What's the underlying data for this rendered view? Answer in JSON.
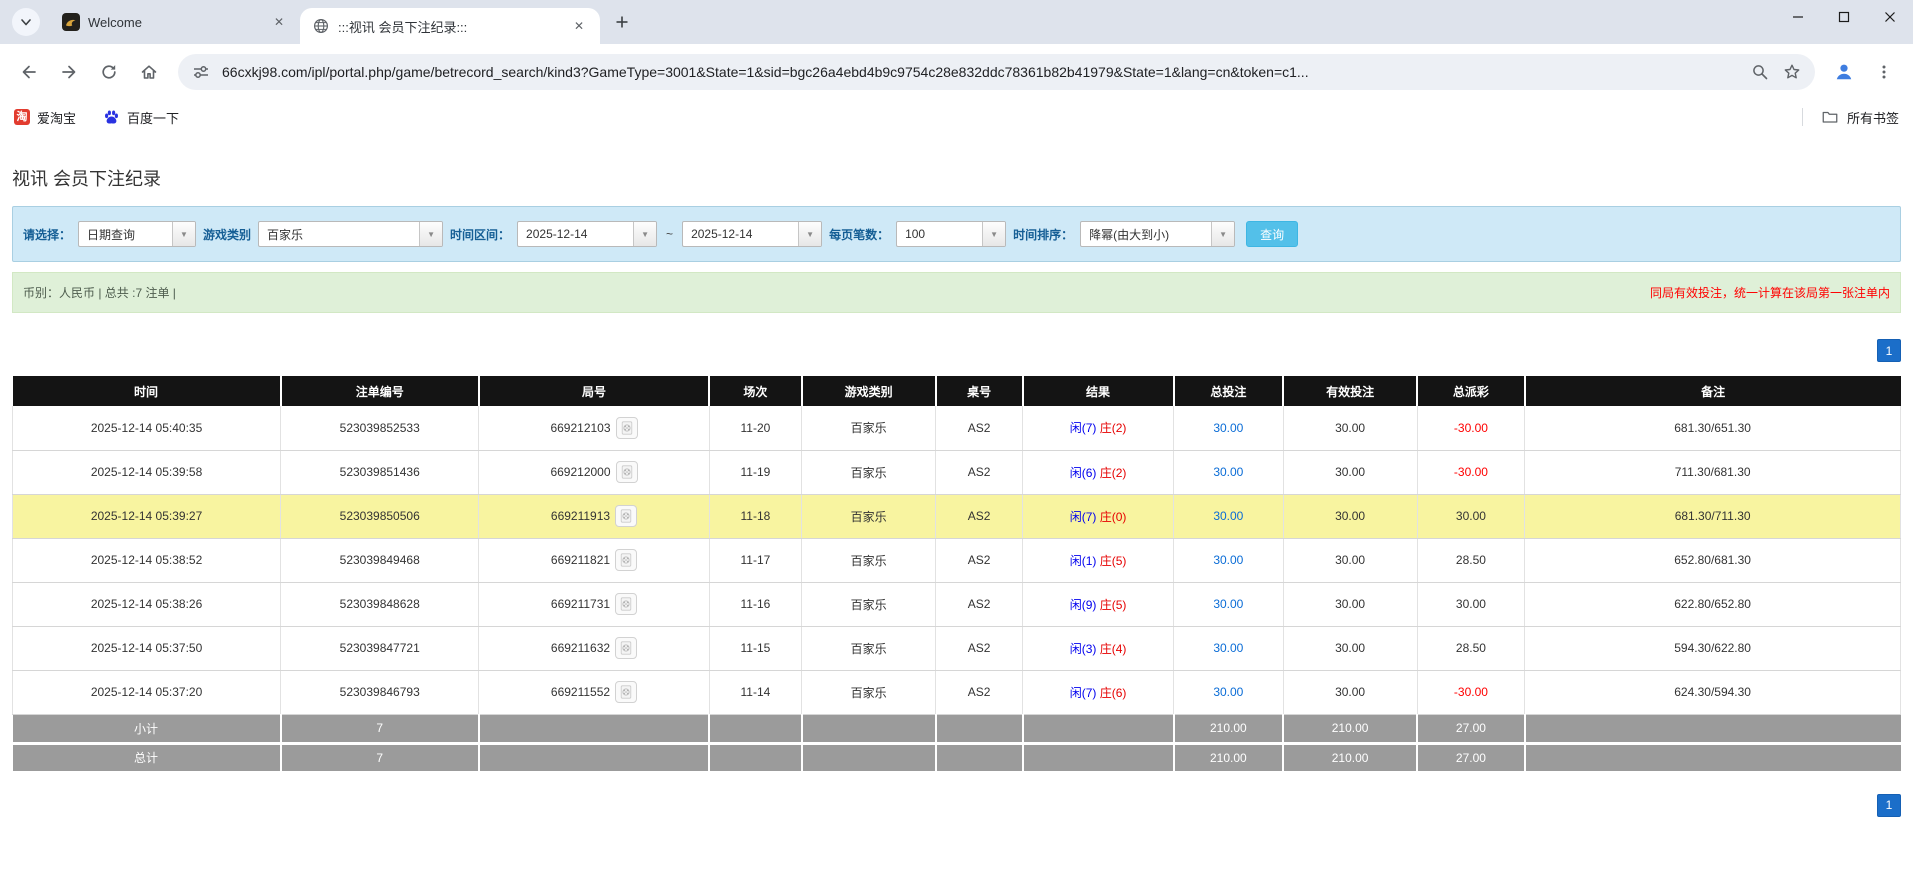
{
  "browser": {
    "tabs": [
      {
        "title": "Welcome"
      },
      {
        "title": ":::视讯 会员下注纪录:::"
      }
    ],
    "url": "66cxkj98.com/ipl/portal.php/game/betrecord_search/kind3?GameType=3001&State=1&sid=bgc26a4ebd4b9c9754c28e832ddc78361b82b41979&State=1&lang=cn&token=c1...",
    "bookmarks": {
      "taobao": "爱淘宝",
      "taobao_icon_char": "淘",
      "baidu": "百度一下",
      "all_bookmarks": "所有书签"
    }
  },
  "icons": {
    "dropdown": "▼",
    "tab_close": "✕"
  },
  "colors": {
    "accent_blue_button": "#53c0e9",
    "pager_blue": "#1b6ec9",
    "filter_panel_bg": "#cfe9f7",
    "info_bar_bg": "#dff0d8",
    "table_header_bg": "#141414",
    "highlight_row_bg": "#f8f4a0",
    "summary_row_bg": "#9b9b9b",
    "link_blue": "#0a6cd6",
    "negative_red": "#ff0000",
    "result_player_blue": "#0000ee",
    "result_banker_red": "#e60000"
  },
  "page": {
    "title": "视讯 会员下注纪录",
    "filters": {
      "select_label": "请选择：",
      "select_value": "日期查询",
      "game_type_label": "游戏类别",
      "game_type_value": "百家乐",
      "date_range_label": "时间区间：",
      "date_from": "2025-12-14",
      "tilde": "~",
      "date_to": "2025-12-14",
      "page_size_label": "每页笔数：",
      "page_size_value": "100",
      "sort_label": "时间排序：",
      "sort_value": "降幂(由大到小)",
      "search_button": "查询"
    },
    "info_bar": {
      "left": "币别：人民币 | 总共 :7 注单 |",
      "right": "同局有效投注，统一计算在该局第一张注单内"
    },
    "pagination": "1",
    "table": {
      "headers": [
        "时间",
        "注单编号",
        "局号",
        "场次",
        "游戏类别",
        "桌号",
        "结果",
        "总投注",
        "有效投注",
        "总派彩",
        "备注"
      ],
      "rows": [
        {
          "time": "2025-12-14 05:40:35",
          "bet_id": "523039852533",
          "round_id": "669212103",
          "session": "11-20",
          "game": "百家乐",
          "table_id": "AS2",
          "result_player": "闲(7)",
          "result_banker": "庄(2)",
          "total_bet": "30.00",
          "valid_bet": "30.00",
          "payout": "-30.00",
          "note": "681.30/651.30",
          "highlighted": false
        },
        {
          "time": "2025-12-14 05:39:58",
          "bet_id": "523039851436",
          "round_id": "669212000",
          "session": "11-19",
          "game": "百家乐",
          "table_id": "AS2",
          "result_player": "闲(6)",
          "result_banker": "庄(2)",
          "total_bet": "30.00",
          "valid_bet": "30.00",
          "payout": "-30.00",
          "note": "711.30/681.30",
          "highlighted": false
        },
        {
          "time": "2025-12-14 05:39:27",
          "bet_id": "523039850506",
          "round_id": "669211913",
          "session": "11-18",
          "game": "百家乐",
          "table_id": "AS2",
          "result_player": "闲(7)",
          "result_banker": "庄(0)",
          "total_bet": "30.00",
          "valid_bet": "30.00",
          "payout": "30.00",
          "note": "681.30/711.30",
          "highlighted": true
        },
        {
          "time": "2025-12-14 05:38:52",
          "bet_id": "523039849468",
          "round_id": "669211821",
          "session": "11-17",
          "game": "百家乐",
          "table_id": "AS2",
          "result_player": "闲(1)",
          "result_banker": "庄(5)",
          "total_bet": "30.00",
          "valid_bet": "30.00",
          "payout": "28.50",
          "note": "652.80/681.30",
          "highlighted": false
        },
        {
          "time": "2025-12-14 05:38:26",
          "bet_id": "523039848628",
          "round_id": "669211731",
          "session": "11-16",
          "game": "百家乐",
          "table_id": "AS2",
          "result_player": "闲(9)",
          "result_banker": "庄(5)",
          "total_bet": "30.00",
          "valid_bet": "30.00",
          "payout": "30.00",
          "note": "622.80/652.80",
          "highlighted": false
        },
        {
          "time": "2025-12-14 05:37:50",
          "bet_id": "523039847721",
          "round_id": "669211632",
          "session": "11-15",
          "game": "百家乐",
          "table_id": "AS2",
          "result_player": "闲(3)",
          "result_banker": "庄(4)",
          "total_bet": "30.00",
          "valid_bet": "30.00",
          "payout": "28.50",
          "note": "594.30/622.80",
          "highlighted": false
        },
        {
          "time": "2025-12-14 05:37:20",
          "bet_id": "523039846793",
          "round_id": "669211552",
          "session": "11-14",
          "game": "百家乐",
          "table_id": "AS2",
          "result_player": "闲(7)",
          "result_banker": "庄(6)",
          "total_bet": "30.00",
          "valid_bet": "30.00",
          "payout": "-30.00",
          "note": "624.30/594.30",
          "highlighted": false
        }
      ],
      "subtotal": {
        "label": "小计",
        "count": "7",
        "total_bet": "210.00",
        "valid_bet": "210.00",
        "payout": "27.00"
      },
      "total": {
        "label": "总计",
        "count": "7",
        "total_bet": "210.00",
        "valid_bet": "210.00",
        "payout": "27.00"
      }
    }
  }
}
